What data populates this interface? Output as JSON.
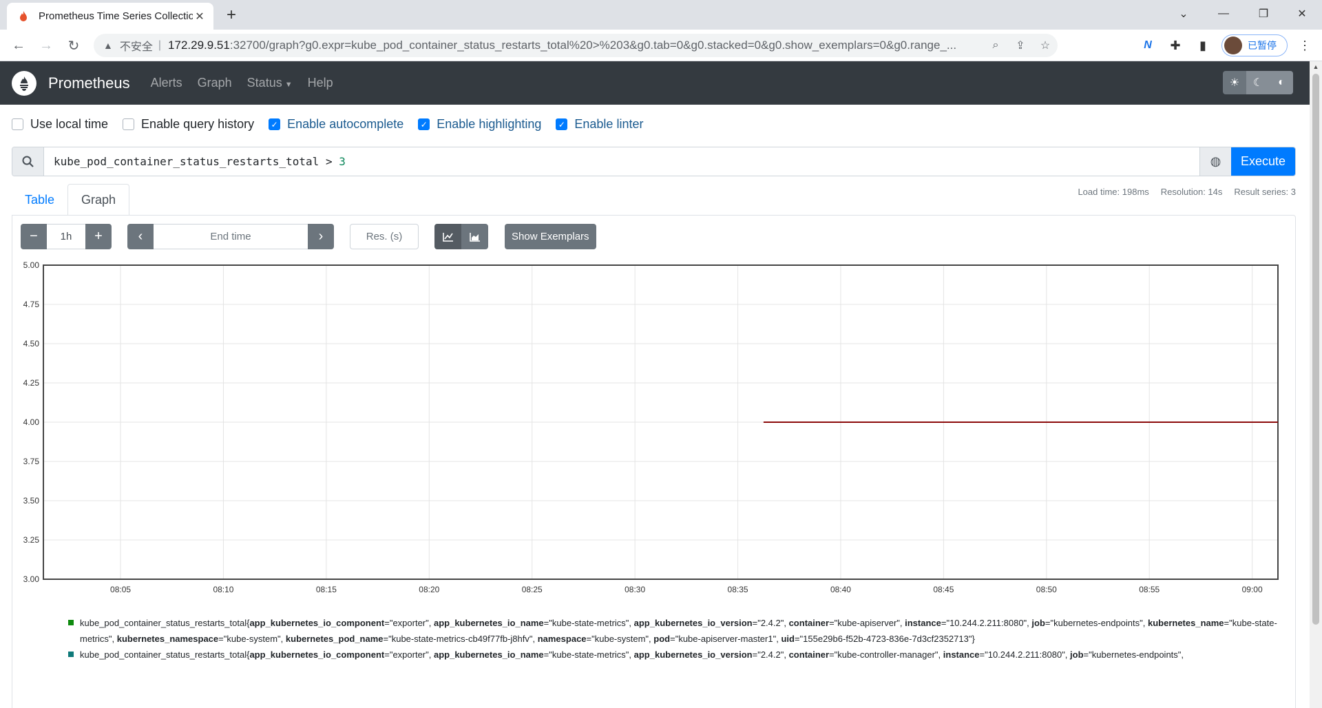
{
  "browser": {
    "tab_title": "Prometheus Time Series Collection and Processing Server",
    "insecure_label": "不安全",
    "separator": "|",
    "url_host": "172.29.9.51",
    "url_rest": ":32700/graph?g0.expr=kube_pod_container_status_restarts_total%20>%203&g0.tab=0&g0.stacked=0&g0.show_exemplars=0&g0.range_...",
    "profile_label": "已暂停"
  },
  "navbar": {
    "brand": "Prometheus",
    "links": [
      "Alerts",
      "Graph",
      "Status",
      "Help"
    ]
  },
  "options": {
    "use_local_time": {
      "label": "Use local time",
      "checked": false
    },
    "query_history": {
      "label": "Enable query history",
      "checked": false
    },
    "autocomplete": {
      "label": "Enable autocomplete",
      "checked": true
    },
    "highlighting": {
      "label": "Enable highlighting",
      "checked": true
    },
    "linter": {
      "label": "Enable linter",
      "checked": true
    }
  },
  "query": {
    "expr_metric": "kube_pod_container_status_restarts_total",
    "expr_op": " > ",
    "expr_num": "3",
    "execute_label": "Execute"
  },
  "tabs": {
    "table": "Table",
    "graph": "Graph"
  },
  "stats": {
    "load_time": "Load time: 198ms",
    "resolution": "Resolution: 14s",
    "result_series": "Result series: 3"
  },
  "controls": {
    "range": "1h",
    "end_time_placeholder": "End time",
    "res_placeholder": "Res. (s)",
    "show_exemplars": "Show Exemplars"
  },
  "chart_data": {
    "type": "line",
    "ylim": [
      3.0,
      5.0
    ],
    "y_ticks": [
      "5.00",
      "4.75",
      "4.50",
      "4.25",
      "4.00",
      "3.75",
      "3.50",
      "3.25",
      "3.00"
    ],
    "x_ticks": [
      "08:05",
      "08:10",
      "08:15",
      "08:20",
      "08:25",
      "08:30",
      "08:35",
      "08:40",
      "08:45",
      "08:50",
      "08:55",
      "09:00"
    ],
    "xlim": [
      "08:01:15",
      "09:01:15"
    ],
    "grid": true,
    "series": [
      {
        "color": "#8b0a0a",
        "start": "08:36:15",
        "end": "09:01:15",
        "value": 4
      }
    ]
  },
  "legend": [
    {
      "color": "#0f8a0f",
      "metric": "kube_pod_container_status_restarts_total",
      "labels": [
        [
          "app_kubernetes_io_component",
          "exporter"
        ],
        [
          "app_kubernetes_io_name",
          "kube-state-metrics"
        ],
        [
          "app_kubernetes_io_version",
          "2.4.2"
        ],
        [
          "container",
          "kube-apiserver"
        ],
        [
          "instance",
          "10.244.2.211:8080"
        ],
        [
          "job",
          "kubernetes-endpoints"
        ],
        [
          "kubernetes_name",
          "kube-state-metrics"
        ],
        [
          "kubernetes_namespace",
          "kube-system"
        ],
        [
          "kubernetes_pod_name",
          "kube-state-metrics-cb49f77fb-j8hfv"
        ],
        [
          "namespace",
          "kube-system"
        ],
        [
          "pod",
          "kube-apiserver-master1"
        ],
        [
          "uid",
          "155e29b6-f52b-4723-836e-7d3cf2352713"
        ]
      ]
    },
    {
      "color": "#0f7a7a",
      "metric": "kube_pod_container_status_restarts_total",
      "labels": [
        [
          "app_kubernetes_io_component",
          "exporter"
        ],
        [
          "app_kubernetes_io_name",
          "kube-state-metrics"
        ],
        [
          "app_kubernetes_io_version",
          "2.4.2"
        ],
        [
          "container",
          "kube-controller-manager"
        ],
        [
          "instance",
          "10.244.2.211:8080"
        ],
        [
          "job",
          "kubernetes-endpoints"
        ]
      ]
    }
  ]
}
